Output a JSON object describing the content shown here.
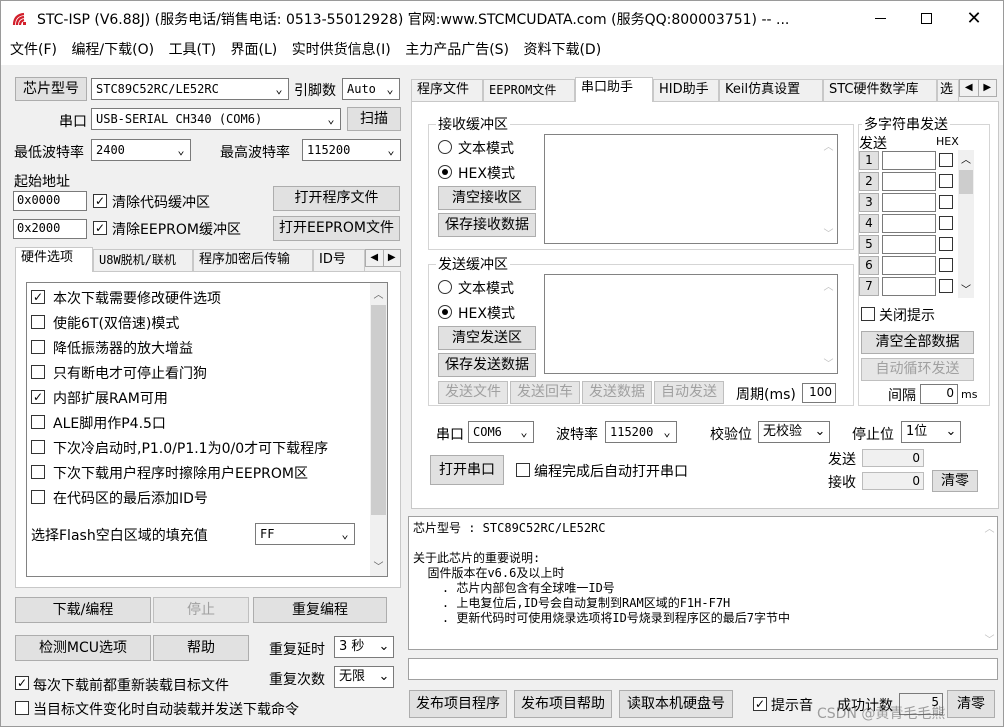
{
  "window": {
    "title": "STC-ISP (V6.88J) (服务电话/销售电话: 0513-55012928) 官网:www.STCMCUDATA.com  (服务QQ:800003751) -- ..."
  },
  "menu": [
    "文件(F)",
    "编程/下载(O)",
    "工具(T)",
    "界面(L)",
    "实时供货信息(I)",
    "主力产品广告(S)",
    "资料下载(D)"
  ],
  "left": {
    "chip_btn": "芯片型号",
    "chip_value": "STC89C52RC/LE52RC",
    "pin_label": "引脚数",
    "pin_value": "Auto",
    "port_label": "串口",
    "port_value": "USB-SERIAL CH340 (COM6)",
    "scan_btn": "扫描",
    "min_baud_label": "最低波特率",
    "min_baud": "2400",
    "max_baud_label": "最高波特率",
    "max_baud": "115200",
    "start_addr_label": "起始地址",
    "addr1": "0x0000",
    "clear_code": "清除代码缓冲区",
    "open_prog": "打开程序文件",
    "addr2": "0x2000",
    "clear_eeprom": "清除EEPROM缓冲区",
    "open_eeprom": "打开EEPROM文件",
    "tabs": [
      "硬件选项",
      "U8W脱机/联机",
      "程序加密后传输",
      "ID号"
    ],
    "options": [
      {
        "label": "本次下载需要修改硬件选项",
        "checked": true
      },
      {
        "label": "使能6T(双倍速)模式",
        "checked": false
      },
      {
        "label": "降低振荡器的放大增益",
        "checked": false
      },
      {
        "label": "只有断电才可停止看门狗",
        "checked": false
      },
      {
        "label": "内部扩展RAM可用",
        "checked": true
      },
      {
        "label": "ALE脚用作P4.5口",
        "checked": false
      },
      {
        "label": "下次冷启动时,P1.0/P1.1为0/0才可下载程序",
        "checked": false
      },
      {
        "label": "下次下载用户程序时擦除用户EEPROM区",
        "checked": false
      },
      {
        "label": "在代码区的最后添加ID号",
        "checked": false
      }
    ],
    "fill_label": "选择Flash空白区域的填充值",
    "fill_value": "FF",
    "download_btn": "下载/编程",
    "stop_btn": "停止",
    "reprogram_btn": "重复编程",
    "detect_btn": "检测MCU选项",
    "help_btn": "帮助",
    "delay_label": "重复延时",
    "delay_value": "3 秒",
    "reload_label": "每次下载前都重新装载目标文件",
    "repeat_label": "重复次数",
    "repeat_value": "无限",
    "autosend_label": "当目标文件变化时自动装载并发送下载命令"
  },
  "right": {
    "tabs": [
      "程序文件",
      "EEPROM文件",
      "串口助手",
      "HID助手",
      "Keil仿真设置",
      "STC硬件数学库",
      "选"
    ],
    "recv_group": "接收缓冲区",
    "text_mode": "文本模式",
    "hex_mode": "HEX模式",
    "clear_recv": "清空接收区",
    "save_recv": "保存接收数据",
    "send_group": "发送缓冲区",
    "clear_send": "清空发送区",
    "save_send": "保存发送数据",
    "send_file": "发送文件",
    "send_return": "发送回车",
    "send_data": "发送数据",
    "auto_send": "自动发送",
    "period_label": "周期(ms)",
    "period_value": "100",
    "multi_group": "多字符串发送",
    "send_col": "发送",
    "hex_col": "HEX",
    "rows": [
      "1",
      "2",
      "3",
      "4",
      "5",
      "6",
      "7"
    ],
    "close_hint": "关闭提示",
    "clear_all": "清空全部数据",
    "auto_loop": "自动循环发送",
    "interval_label": "间隔",
    "interval_value": "0",
    "interval_unit": "ms",
    "port_label": "串口",
    "port_value": "COM6",
    "baud_label": "波特率",
    "baud_value": "115200",
    "parity_label": "校验位",
    "parity_value": "无校验",
    "stop_label": "停止位",
    "stop_value": "1位",
    "open_port": "打开串口",
    "auto_open": "编程完成后自动打开串口",
    "sent_label": "发送",
    "sent_value": "0",
    "recv_label": "接收",
    "recv_value": "0",
    "clear_count": "清零"
  },
  "info": {
    "lines": [
      "芯片型号 : STC89C52RC/LE52RC",
      "",
      "关于此芯片的重要说明:",
      "  固件版本在v6.6及以上时",
      "    . 芯片内部包含有全球唯一ID号",
      "    . 上电复位后,ID号会自动复制到RAM区域的F1H-F7H",
      "    . 更新代码时可使用烧录选项将ID号烧录到程序区的最后7字节中"
    ]
  },
  "bottom": {
    "publish_prog": "发布项目程序",
    "publish_help": "发布项目帮助",
    "read_disk": "读取本机硬盘号",
    "beep_label": "提示音",
    "success_label": "成功计数",
    "success_value": "5",
    "clear_btn": "清零"
  },
  "watermark": "CSDN @黄青毛毛熊"
}
